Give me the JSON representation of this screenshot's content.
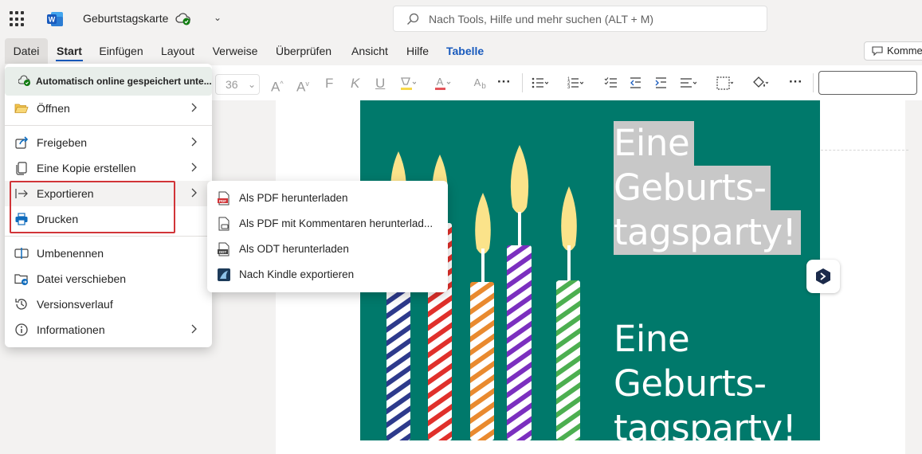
{
  "header": {
    "doc_title": "Geburtstagskarte",
    "search_placeholder": "Nach Tools, Hilfe und mehr suchen (ALT + M)"
  },
  "tabs": [
    {
      "label": "Datei"
    },
    {
      "label": "Start"
    },
    {
      "label": "Einfügen"
    },
    {
      "label": "Layout"
    },
    {
      "label": "Verweise"
    },
    {
      "label": "Überprüfen"
    },
    {
      "label": "Ansicht"
    },
    {
      "label": "Hilfe"
    },
    {
      "label": "Tabelle"
    }
  ],
  "comments_label": "Kommer",
  "ribbon": {
    "font_size": "36",
    "bold": "F",
    "italic": "K",
    "underline": "U"
  },
  "file_menu": {
    "autosave": "Automatisch online gespeichert unte...",
    "items": [
      {
        "label": "Öffnen"
      },
      {
        "label": "Freigeben"
      },
      {
        "label": "Eine Kopie erstellen"
      },
      {
        "label": "Exportieren"
      },
      {
        "label": "Drucken"
      },
      {
        "label": "Umbenennen"
      },
      {
        "label": "Datei verschieben"
      },
      {
        "label": "Versionsverlauf"
      },
      {
        "label": "Informationen"
      }
    ]
  },
  "export_menu": {
    "items": [
      {
        "label": "Als PDF herunterladen"
      },
      {
        "label": "Als PDF mit Kommentaren herunterlad..."
      },
      {
        "label": "Als ODT herunterladen"
      },
      {
        "label": "Nach Kindle exportieren"
      }
    ]
  },
  "document": {
    "selected_title": [
      "Eine",
      "Geburts-",
      "tagsparty!"
    ],
    "title": [
      "Eine",
      "Geburts-",
      "tagsparty!"
    ]
  },
  "colors": {
    "card_green": "#00796b",
    "word_blue": "#185abd",
    "highlight_red": "#d13438"
  }
}
